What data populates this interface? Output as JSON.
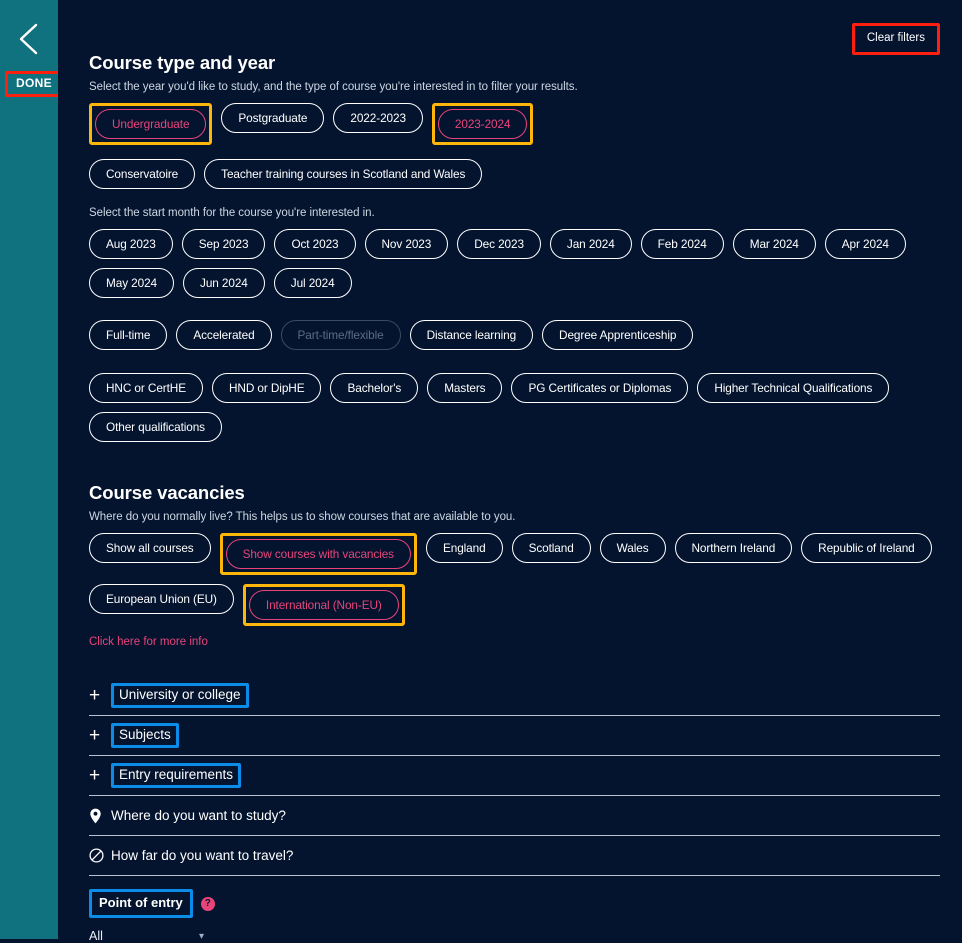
{
  "sidebar": {
    "back_icon": "chevron-left-icon",
    "done_label": "DONE"
  },
  "header": {
    "clear_filters_label": "Clear filters"
  },
  "course_type": {
    "title": "Course type and year",
    "subtitle": "Select the year you'd like to study, and the type of course you're interested in to filter your results.",
    "level_year_chips": [
      {
        "label": "Undergraduate",
        "state": "selected",
        "annotated": true
      },
      {
        "label": "Postgraduate",
        "state": "default",
        "annotated": false
      },
      {
        "label": "2022-2023",
        "state": "default",
        "annotated": false
      },
      {
        "label": "2023-2024",
        "state": "selected",
        "annotated": true
      }
    ],
    "extra_chips": [
      {
        "label": "Conservatoire",
        "state": "default",
        "annotated": false
      },
      {
        "label": "Teacher training courses in Scotland and Wales",
        "state": "default",
        "annotated": false
      }
    ],
    "month_subtitle": "Select the start month for the course you're interested in.",
    "month_chips_row1": [
      {
        "label": "Aug 2023",
        "state": "default"
      },
      {
        "label": "Sep 2023",
        "state": "default"
      },
      {
        "label": "Oct 2023",
        "state": "default"
      },
      {
        "label": "Nov 2023",
        "state": "default"
      },
      {
        "label": "Dec 2023",
        "state": "default"
      },
      {
        "label": "Jan 2024",
        "state": "default"
      },
      {
        "label": "Feb 2024",
        "state": "default"
      },
      {
        "label": "Mar 2024",
        "state": "default"
      },
      {
        "label": "Apr 2024",
        "state": "default"
      }
    ],
    "month_chips_row2": [
      {
        "label": "May 2024",
        "state": "default"
      },
      {
        "label": "Jun 2024",
        "state": "default"
      },
      {
        "label": "Jul 2024",
        "state": "default"
      }
    ],
    "study_mode_chips": [
      {
        "label": "Full-time",
        "state": "default"
      },
      {
        "label": "Accelerated",
        "state": "default"
      },
      {
        "label": "Part-time/flexible",
        "state": "disabled"
      },
      {
        "label": "Distance learning",
        "state": "default"
      },
      {
        "label": "Degree Apprenticeship",
        "state": "default"
      }
    ],
    "qualification_chips": [
      {
        "label": "HNC or CertHE",
        "state": "default"
      },
      {
        "label": "HND or DipHE",
        "state": "default"
      },
      {
        "label": "Bachelor's",
        "state": "default"
      },
      {
        "label": "Masters",
        "state": "default"
      },
      {
        "label": "PG Certificates or Diplomas",
        "state": "default"
      },
      {
        "label": "Higher Technical Qualifications",
        "state": "default"
      },
      {
        "label": "Other qualifications",
        "state": "default"
      }
    ]
  },
  "course_vacancies": {
    "title": "Course vacancies",
    "subtitle": "Where do you normally live? This helps us to show courses that are available to you.",
    "chips_row1": [
      {
        "label": "Show all courses",
        "state": "default",
        "annotated": false
      },
      {
        "label": "Show courses with vacancies",
        "state": "selected",
        "annotated": true
      },
      {
        "label": "England",
        "state": "default",
        "annotated": false
      },
      {
        "label": "Scotland",
        "state": "default",
        "annotated": false
      },
      {
        "label": "Wales",
        "state": "default",
        "annotated": false
      },
      {
        "label": "Northern Ireland",
        "state": "default",
        "annotated": false
      },
      {
        "label": "Republic of Ireland",
        "state": "default",
        "annotated": false
      }
    ],
    "chips_row2": [
      {
        "label": "European Union (EU)",
        "state": "default",
        "annotated": false
      },
      {
        "label": "International (Non-EU)",
        "state": "selected",
        "annotated": true
      }
    ],
    "more_info_label": "Click here for more info"
  },
  "accordion": [
    {
      "label": "University or college",
      "icon": "plus-icon",
      "annotated": true
    },
    {
      "label": "Subjects",
      "icon": "plus-icon",
      "annotated": true
    },
    {
      "label": "Entry requirements",
      "icon": "plus-icon",
      "annotated": true
    },
    {
      "label": "Where do you want to study?",
      "icon": "map-pin-icon",
      "annotated": false
    },
    {
      "label": "How far do you want to travel?",
      "icon": "circle-slash-icon",
      "annotated": false
    }
  ],
  "point_of_entry": {
    "label": "Point of entry",
    "help_icon": "question-mark-icon",
    "help_glyph": "?",
    "selected_value": "All",
    "caret": "chevron-down-icon"
  },
  "colors": {
    "sidebar_teal": "#10727e",
    "background_navy": "#04142e",
    "accent_pink": "#e8447a",
    "annotation_red": "#ff1f0f",
    "annotation_gold": "#ffb60a",
    "annotation_blue": "#0c8ce9"
  }
}
